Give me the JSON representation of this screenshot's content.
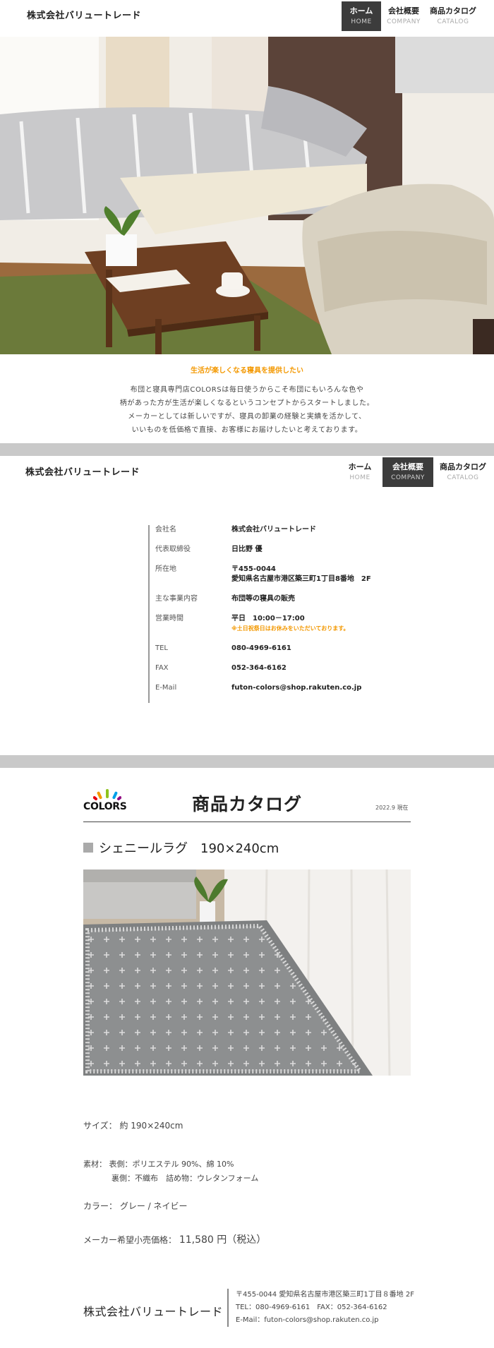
{
  "header": {
    "brand": "株式会社バリュートレード",
    "nav": [
      {
        "ja": "ホーム",
        "en": "HOME"
      },
      {
        "ja": "会社概要",
        "en": "COMPANY"
      },
      {
        "ja": "商品カタログ",
        "en": "CATALOG"
      }
    ]
  },
  "intro": {
    "tagline": "生活が楽しくなる寝具を提供したい",
    "lines": [
      "布団と寝具専門店COLORSは毎日使うからこそ布団にもいろんな色や",
      "柄があった方が生活が楽しくなるというコンセプトからスタートしました。",
      "メーカーとしては新しいですが、寝具の卸業の経験と実績を活かして、",
      "いいものを低価格で直接、お客様にお届けしたいと考えております。"
    ]
  },
  "company": {
    "rows": [
      {
        "label": "会社名",
        "value": "株式会社バリュートレード"
      },
      {
        "label": "代表取締役",
        "value": "日比野 優"
      },
      {
        "label": "所在地",
        "value": "〒455-0044",
        "value2": "愛知県名古屋市港区築三町1丁目8番地　2F"
      },
      {
        "label": "主な事業内容",
        "value": "布団等の寝具の販売"
      },
      {
        "label": "営業時間",
        "value": "平日　10:00－17:00",
        "note": "※土日祝祭日はお休みをいただいております。"
      },
      {
        "label": "TEL",
        "value": "080-4969-6161"
      },
      {
        "label": "FAX",
        "value": "052-364-6162"
      },
      {
        "label": "E-Mail",
        "value": "futon-colors@shop.rakuten.co.jp"
      }
    ]
  },
  "catalog": {
    "logo": "COLORS",
    "logo_colors": [
      "#e60012",
      "#f39800",
      "#8fc31f",
      "#00a0e9",
      "#920783"
    ],
    "title": "商品カタログ",
    "date": "2022.9 現在",
    "product_name": "シェニールラグ　190×240cm",
    "size_label": "サイズ：",
    "size_value": "約 190×240cm",
    "material_label": "素材：",
    "material_front": "表側：ポリエステル 90%、綿 10%",
    "material_back": "裏側：不織布　詰め物：ウレタンフォーム",
    "color_label": "カラー：",
    "color_value": "グレー / ネイビー",
    "price_label": "メーカー希望小売価格：",
    "price_value": "11,580 円（税込）"
  },
  "footer": {
    "brand": "株式会社バリュートレード",
    "address": "〒455-0044 愛知県名古屋市港区築三町1丁目８番地 2F",
    "tel_fax": "TEL：080-4969-6161　FAX：052-364-6162",
    "email": "E-Mail：futon-colors@shop.rakuten.co.jp"
  }
}
